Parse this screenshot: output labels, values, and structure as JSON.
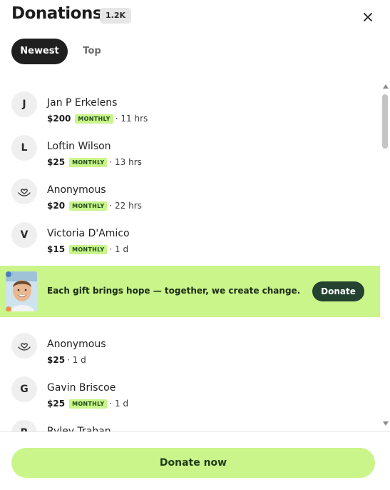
{
  "header": {
    "title": "Donations",
    "count": "1.2K",
    "close_icon": "close-icon"
  },
  "tabs": [
    {
      "label": "Newest",
      "active": true
    },
    {
      "label": "Top",
      "active": false
    }
  ],
  "donations": [
    {
      "initial": "J",
      "name": "Jan P Erkelens",
      "amount": "$200",
      "badge": "MONTHLY",
      "time": "· 11 hrs"
    },
    {
      "initial": "L",
      "name": "Loftin Wilson",
      "amount": "$25",
      "badge": "MONTHLY",
      "time": "· 13 hrs"
    },
    {
      "initial": "",
      "icon": "heart-hand-icon",
      "name": "Anonymous",
      "amount": "$20",
      "badge": "MONTHLY",
      "time": "· 22 hrs"
    },
    {
      "initial": "V",
      "name": "Victoria D'Amico",
      "amount": "$15",
      "badge": "MONTHLY",
      "time": "· 1 d"
    },
    {
      "initial": "",
      "icon": "heart-hand-icon",
      "name": "Anonymous",
      "amount": "$25",
      "badge": "",
      "time": "· 1 d"
    },
    {
      "initial": "G",
      "name": "Gavin Briscoe",
      "amount": "$25",
      "badge": "MONTHLY",
      "time": "· 1 d"
    },
    {
      "initial": "R",
      "name": "Ryley Trahan",
      "amount": "",
      "badge": "",
      "time": ""
    }
  ],
  "promo": {
    "text": "Each gift brings hope — together, we create change.",
    "button_label": "Donate"
  },
  "footer": {
    "donate_now_label": "Donate now"
  },
  "colors": {
    "accent": "#c9f58a",
    "dark_green": "#234330",
    "tab_active_bg": "#1f1f1f"
  }
}
